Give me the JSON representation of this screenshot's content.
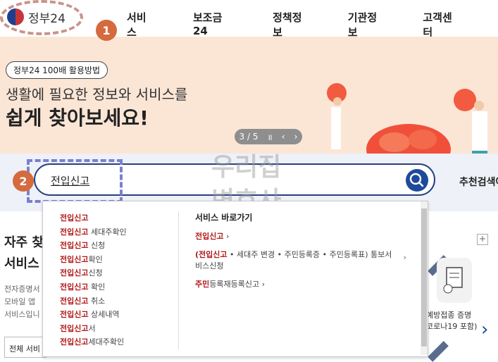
{
  "header": {
    "logo_text": "정부24",
    "nav": [
      "서비스",
      "보조금24",
      "정책정보",
      "기관정보",
      "고객센터"
    ]
  },
  "annotations": {
    "badge1": "1",
    "badge2": "2"
  },
  "banner": {
    "pill": "정부24 100배 활용방법",
    "headline1": "생활에 필요한 정보와 서비스를",
    "headline2": "쉽게 찾아보세요!",
    "pager": "3 / 5",
    "pause": "॥",
    "prev": "‹",
    "next": "›"
  },
  "search": {
    "value": "전입신고",
    "recommend_label": "추천검색어"
  },
  "watermark": {
    "line1": "우리집",
    "line2": "변호사"
  },
  "autocomplete": {
    "items": [
      {
        "hl": "전입신고",
        "rest": ""
      },
      {
        "hl": "전입신고",
        "rest": " 세대주확인"
      },
      {
        "hl": "전입신고",
        "rest": " 신청"
      },
      {
        "hl": "전입신고",
        "rest": "확인"
      },
      {
        "hl": "전입신고",
        "rest": "신청"
      },
      {
        "hl": "전입신고",
        "rest": " 확인"
      },
      {
        "hl": "전입신고",
        "rest": " 취소"
      },
      {
        "hl": "전입신고",
        "rest": " 상세내역"
      },
      {
        "hl": "전입신고",
        "rest": "서"
      },
      {
        "hl": "전입신고",
        "rest": "세대주확인"
      }
    ],
    "shortcut_title": "서비스 바로가기",
    "shortcuts": [
      {
        "hl": "전입신고",
        "rest": " ›"
      },
      {
        "hl": "(전입신고",
        "rest": " • 세대주 변경 • 주민등록증 • 주민등록표) 통보서 비스신청"
      },
      {
        "hl": "주민",
        "rest": "등록재등록신고 ›"
      }
    ]
  },
  "left": {
    "title1": "자주 찾",
    "title2": "서비스",
    "sub1": "전자증명서",
    "sub2": "모바일 앱",
    "sub3": "서비스입니",
    "all_button": "전체 서비"
  },
  "right": {
    "plus": "+",
    "card_line1": "예방접종 증명",
    "card_line2": "코로나19 포함)"
  }
}
